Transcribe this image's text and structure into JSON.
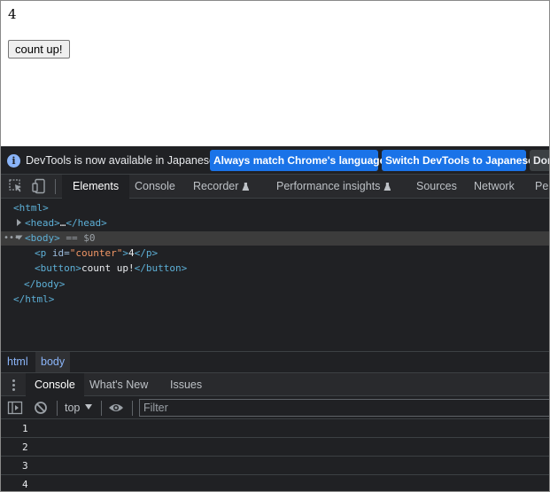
{
  "page": {
    "counter": "4",
    "button_label": "count up!"
  },
  "devtools": {
    "infobar": {
      "message": "DevTools is now available in Japanese!",
      "btn_match": "Always match Chrome's language",
      "btn_switch": "Switch DevTools to Japanese",
      "btn_dont": "Don't show again"
    },
    "tabs": [
      {
        "label": "Elements"
      },
      {
        "label": "Console"
      },
      {
        "label": "Recorder"
      },
      {
        "label": "Performance insights"
      },
      {
        "label": "Sources"
      },
      {
        "label": "Network"
      },
      {
        "label": "Performance"
      }
    ],
    "dom": {
      "html_open": "<html>",
      "head_open": "<head>",
      "head_ellipsis": "…",
      "head_close": "</head>",
      "body_open": "<body>",
      "body_selected": "== $0",
      "p_open_start": "<p ",
      "p_attr_name": "id=",
      "p_attr_value": "\"counter\"",
      "p_open_end": ">",
      "p_text": "4",
      "p_close": "</p>",
      "button_open": "<button>",
      "button_text": "count up!",
      "button_close": "</button>",
      "body_close": "</body>",
      "html_close": "</html>",
      "dots": "•••"
    },
    "breadcrumbs": [
      "html",
      "body"
    ],
    "drawer_tabs": [
      "Console",
      "What's New",
      "Issues"
    ],
    "console": {
      "context": "top",
      "filter_placeholder": "Filter",
      "messages": [
        "1",
        "2",
        "3",
        "4"
      ]
    }
  },
  "colors": {
    "devtools_bg": "#202124",
    "accent_button": "#1a73e8",
    "tag_color": "#5db0d7",
    "attr_value_color": "#f29766"
  }
}
